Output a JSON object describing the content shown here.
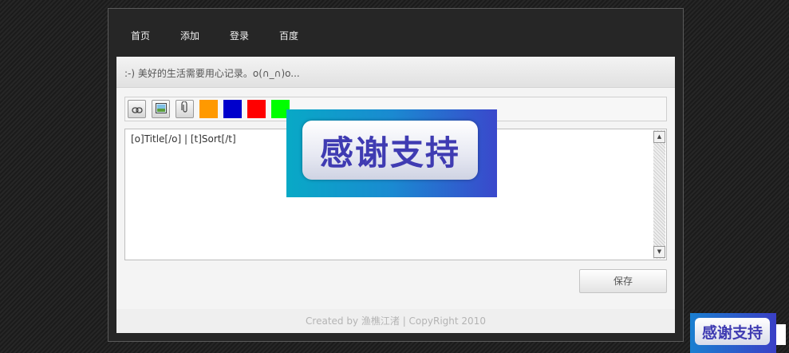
{
  "nav": {
    "items": [
      "首页",
      "添加",
      "登录",
      "百度"
    ]
  },
  "header": {
    "motto": ":-) 美好的生活需要用心记录。o(∩_∩)o..."
  },
  "toolbar": {
    "buttons": [
      {
        "name": "link-icon"
      },
      {
        "name": "image-icon"
      },
      {
        "name": "attachment-icon"
      }
    ],
    "colors": [
      "#ff9900",
      "#0000cc",
      "#ff0000",
      "#00ff00"
    ]
  },
  "editor": {
    "value": "[o]Title[/o] | [t]Sort[/t]"
  },
  "actions": {
    "save_label": "保存"
  },
  "footer": {
    "text": "Created by 渔樵江渚 | CopyRight 2010"
  },
  "overlay": {
    "banner_text": "感谢支持",
    "banner_small_text": "感谢支持"
  }
}
